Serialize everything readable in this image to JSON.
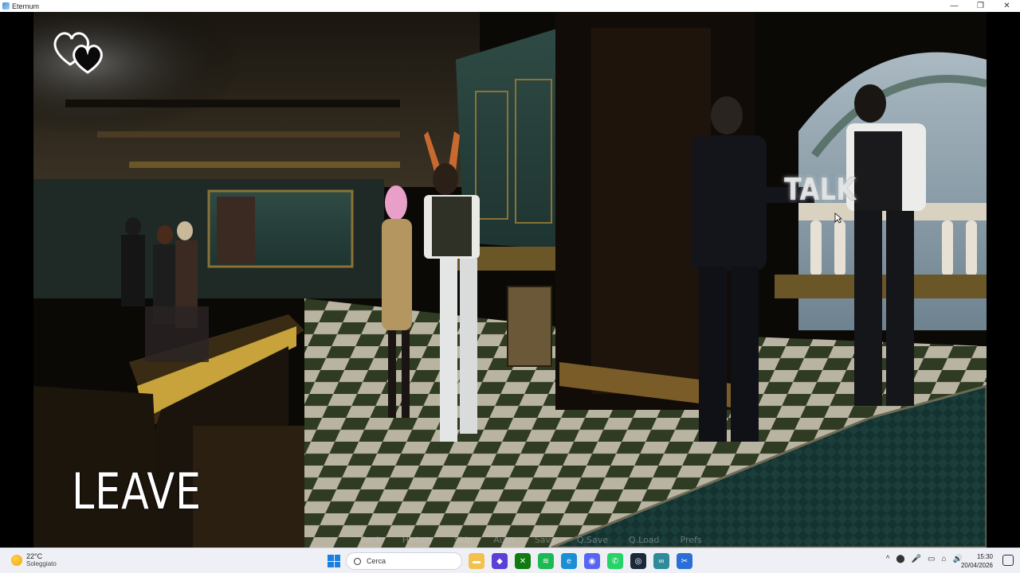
{
  "window": {
    "title": "Eternum",
    "minimize_glyph": "—",
    "maximize_glyph": "❐",
    "close_glyph": "✕"
  },
  "game": {
    "hearts_icon": "double-hearts-icon",
    "leave_label": "LEAVE",
    "talk_label": "TALK",
    "quick_menu": [
      "Back",
      "History",
      "Skip",
      "Auto",
      "Save",
      "Q.Save",
      "Q.Load",
      "Prefs"
    ]
  },
  "taskbar": {
    "weather_temp": "22°C",
    "weather_condition": "Soleggiato",
    "search_placeholder": "Cerca",
    "apps": [
      {
        "icon": "file-explorer-icon",
        "color": "#f2c14e",
        "glyph": "▬"
      },
      {
        "icon": "proton-vpn-icon",
        "color": "#5b3fd6",
        "glyph": "◆"
      },
      {
        "icon": "xbox-icon",
        "color": "#107c10",
        "glyph": "✕"
      },
      {
        "icon": "spotify-icon",
        "color": "#1db954",
        "glyph": "≋"
      },
      {
        "icon": "edge-icon",
        "color": "#1a8fd6",
        "glyph": "e"
      },
      {
        "icon": "discord-icon",
        "color": "#5865f2",
        "glyph": "◉"
      },
      {
        "icon": "whatsapp-icon",
        "color": "#25d366",
        "glyph": "✆"
      },
      {
        "icon": "steam-icon",
        "color": "#1b2838",
        "glyph": "◎"
      },
      {
        "icon": "infinity-app-icon",
        "color": "#2e8b9a",
        "glyph": "∞"
      },
      {
        "icon": "snipping-tool-icon",
        "color": "#2b6fd6",
        "glyph": "✂"
      }
    ],
    "tray_glyphs": [
      "^",
      "⬤",
      "🎤",
      "▭",
      "⌂",
      "🔊"
    ],
    "time": "15:30",
    "date": "20/04/2026"
  }
}
